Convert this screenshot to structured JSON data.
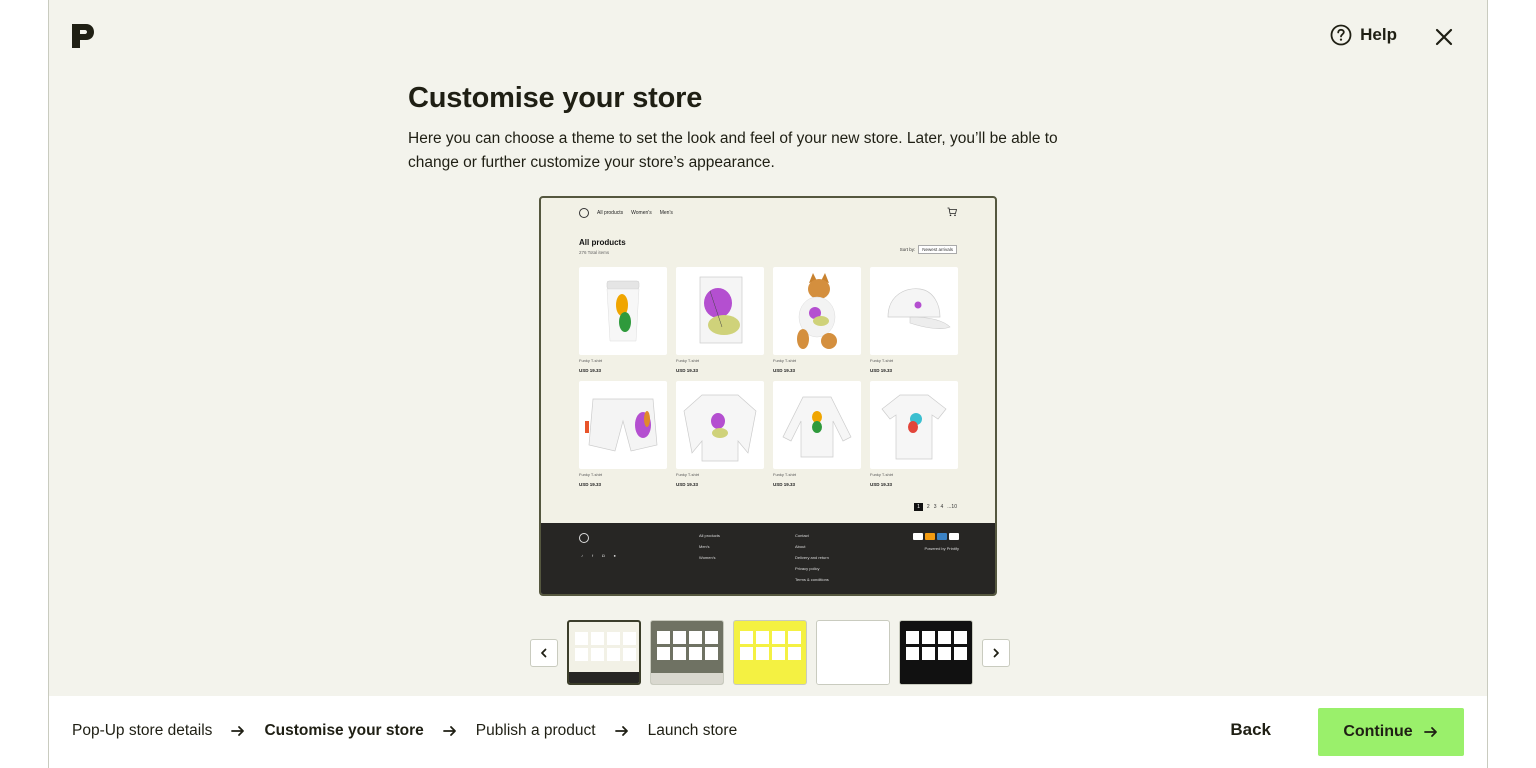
{
  "header": {
    "logo_icon": "printify-p-logo",
    "help_label": "Help",
    "help_icon": "question-circle-icon",
    "close_icon": "close-icon"
  },
  "main": {
    "title": "Customise your store",
    "description": "Here you can choose a theme to set the look and feel of your new store. Later, you’ll be able to change or further customize your store’s appearance."
  },
  "preview": {
    "nav_links": [
      "All products",
      "Women's",
      "Men's"
    ],
    "heading": "All products",
    "count": "276 Total items",
    "sort_label": "Sort by:",
    "sort_value": "Newest arrivals",
    "products": [
      {
        "name": "Funky T-shirt",
        "price": "USD 19.33"
      },
      {
        "name": "Funky T-shirt",
        "price": "USD 19.33"
      },
      {
        "name": "Funky T-shirt",
        "price": "USD 19.33"
      },
      {
        "name": "Funky T-shirt",
        "price": "USD 19.33"
      },
      {
        "name": "Funky T-shirt",
        "price": "USD 19.33"
      },
      {
        "name": "Funky T-shirt",
        "price": "USD 19.33"
      },
      {
        "name": "Funky T-shirt",
        "price": "USD 19.33"
      },
      {
        "name": "Funky T-shirt",
        "price": "USD 19.33"
      }
    ],
    "pages": [
      "1",
      "2",
      "3",
      "4",
      "...10"
    ],
    "footer_col1": [
      "All products",
      "Men's",
      "Women's"
    ],
    "footer_col2": [
      "Contact",
      "About",
      "Delivery and return",
      "Privacy policy",
      "Terms & conditions"
    ],
    "powered_by": "Powered by Printify"
  },
  "themes": [
    {
      "bg": "#f2f1e6",
      "footer": "#272624"
    },
    {
      "bg": "#6f7263",
      "footer": "#d9d8cf"
    },
    {
      "bg": "#f4f142",
      "footer": "#f4f142"
    },
    {
      "bg": "#ffffff",
      "footer": "#ffffff"
    },
    {
      "bg": "#111111",
      "footer": "#111111"
    }
  ],
  "footer": {
    "steps": [
      "Pop-Up store details",
      "Customise your store",
      "Publish a product",
      "Launch store"
    ],
    "back_label": "Back",
    "continue_label": "Continue"
  },
  "colors": {
    "accent": "#9af06b",
    "text": "#1f1f14",
    "background": "#f3f3ec"
  }
}
